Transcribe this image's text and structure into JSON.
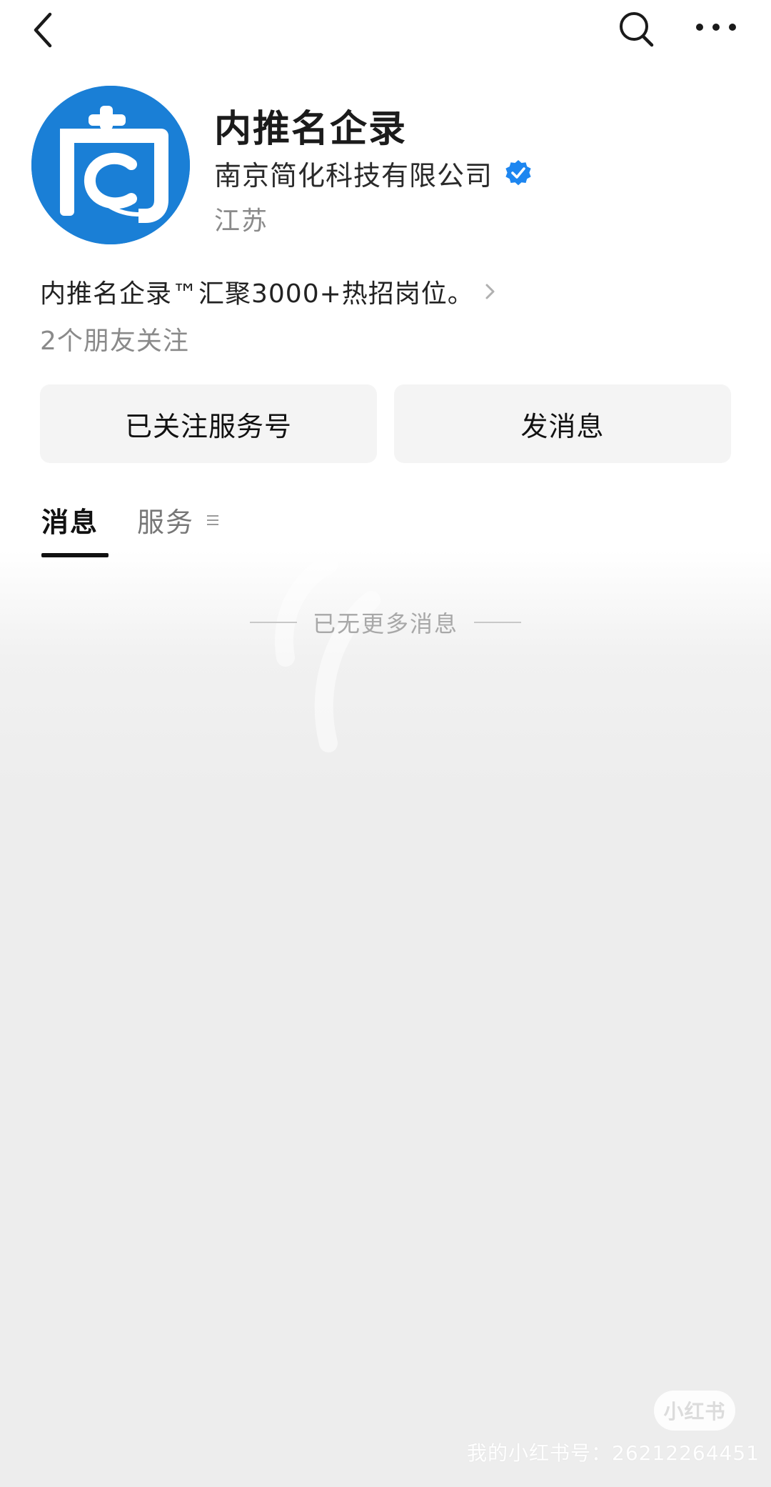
{
  "nav": {
    "back_icon": "chevron-left-icon",
    "search_icon": "search-icon",
    "more_icon": "more-horizontal-icon"
  },
  "profile": {
    "name": "内推名企录",
    "company": "南京简化科技有限公司",
    "verified_icon": "verified-badge-icon",
    "region": "江苏",
    "intro": "内推名企录™汇聚3000+热招岗位。",
    "friends_following": "2个朋友关注"
  },
  "actions": {
    "followed_label": "已关注服务号",
    "message_label": "发消息"
  },
  "tabs": [
    {
      "label": "消息",
      "active": true
    },
    {
      "label": "服务",
      "active": false
    }
  ],
  "content": {
    "empty_text": "已无更多消息"
  },
  "watermark": {
    "badge": "小红书",
    "id_text": "我的小红书号：26212264451"
  },
  "colors": {
    "brand_blue": "#1a7fd6",
    "verified_blue": "#1d86f0",
    "background": "#ededed"
  }
}
